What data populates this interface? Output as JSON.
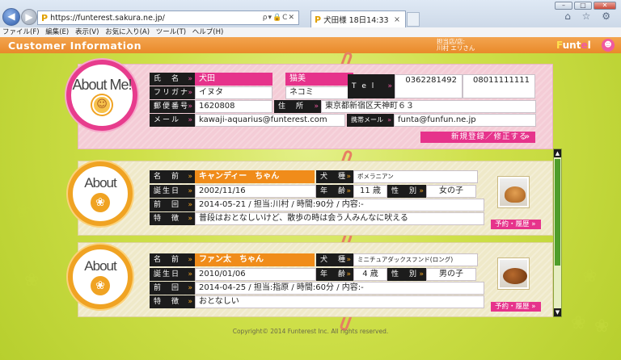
{
  "browser": {
    "url": "https://funterest.sakura.ne.jp/",
    "tab_title": "犬田様 18日14:33",
    "address_icons": "ρ▾🔒C✕",
    "back_icon": "arrow-left-icon",
    "forward_icon": "arrow-right-icon",
    "toolbar_icons": "⌂ ☆ ⚙",
    "menu": [
      "ファイル(F)",
      "編集(E)",
      "表示(V)",
      "お気に入り(A)",
      "ツール(T)",
      "ヘルプ(H)"
    ]
  },
  "header": {
    "title": "Customer Information",
    "user_label": "担当店/店:",
    "user_name": "川村 エリさん",
    "logo_a": "F",
    "logo_b": "unt",
    "logo_c": "e",
    "logo_d": "l",
    "logo_mark": "☻"
  },
  "owner": {
    "bubble_text": "About Me!",
    "name_label": "氏　名",
    "name_last": "犬田",
    "name_first": "猫美",
    "kana_label": "フリガナ",
    "kana_last": "イヌタ",
    "kana_first": "ネコミ",
    "tel_label": "T e l",
    "tel1": "0362281492",
    "tel2": "08011111111",
    "zip_label": "郵便番号",
    "zip": "1620808",
    "address_label": "住　所",
    "address": "東京都新宿区天神町６３",
    "email_label": "メール",
    "email": "kawaji-aquarius@funterest.com",
    "mobile_email_label": "携帯メール",
    "mobile_email": "funta@funfun.ne.jp",
    "submit_label": "新規登録／修正する",
    "submit_arrow": "»"
  },
  "pets": [
    {
      "bubble_text": "About",
      "name_label": "名　前",
      "name": "キャンディー　ちゃん",
      "breed_label": "犬　種",
      "breed": "ポメラニアン",
      "birthday_label": "誕生日",
      "birthday": "2002/11/16",
      "age_label": "年　齢",
      "age": "11 歳",
      "sex_label": "性　別",
      "sex": "女の子",
      "last_visit_label": "前　回",
      "last_visit": "2014-05-21 / 担当:川村 / 時間:90分 / 内容:-",
      "feature_label": "特　徴",
      "feature": "普段はおとなしいけど、散歩の時は会う人みんなに吠える",
      "history_label": "予約・履歴 »"
    },
    {
      "bubble_text": "About",
      "name_label": "名　前",
      "name": "ファン太　ちゃん",
      "breed_label": "犬　種",
      "breed": "ミニチュアダックスフンド(ロング)",
      "birthday_label": "誕生日",
      "birthday": "2010/01/06",
      "age_label": "年　齢",
      "age": "4 歳",
      "sex_label": "性　別",
      "sex": "男の子",
      "last_visit_label": "前　回",
      "last_visit": "2014-04-25 / 担当:指原 / 時間:60分 / 内容:-",
      "feature_label": "特　徴",
      "feature": "おとなしい",
      "history_label": "予約・履歴 »"
    }
  ],
  "footer": "Copyright© 2014 Funterest Inc. All rights reserved."
}
